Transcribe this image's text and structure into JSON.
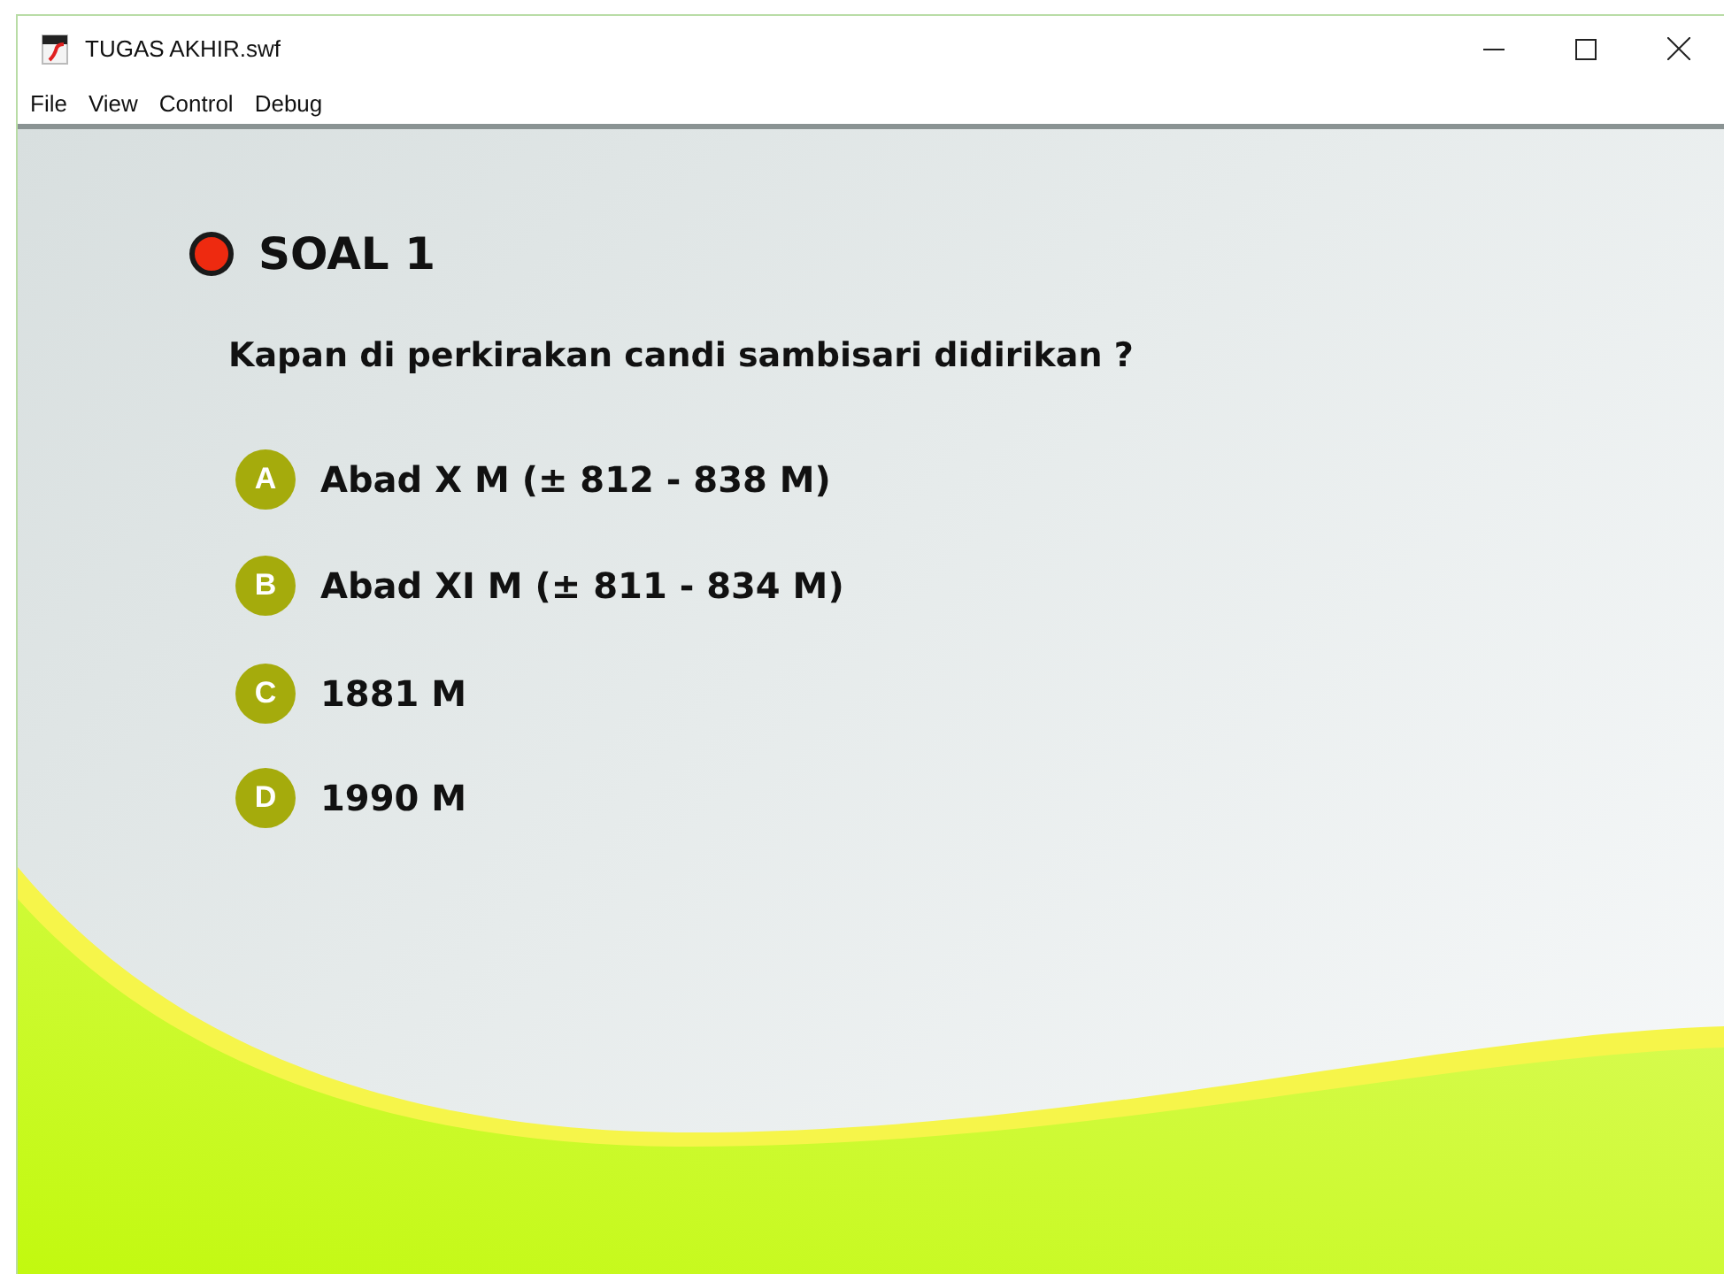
{
  "window": {
    "title": "TUGAS AKHIR.swf"
  },
  "menu": [
    "File",
    "View",
    "Control",
    "Debug"
  ],
  "heading": "SOAL 1",
  "question": "Kapan di perkirakan candi sambisari didirikan ?",
  "options": [
    {
      "letter": "A",
      "text": "Abad X M (± 812 - 838 M)"
    },
    {
      "letter": "B",
      "text": "Abad XI M (± 811 - 834 M)"
    },
    {
      "letter": "C",
      "text": "1881 M"
    },
    {
      "letter": "D",
      "text": "1990 M"
    }
  ]
}
